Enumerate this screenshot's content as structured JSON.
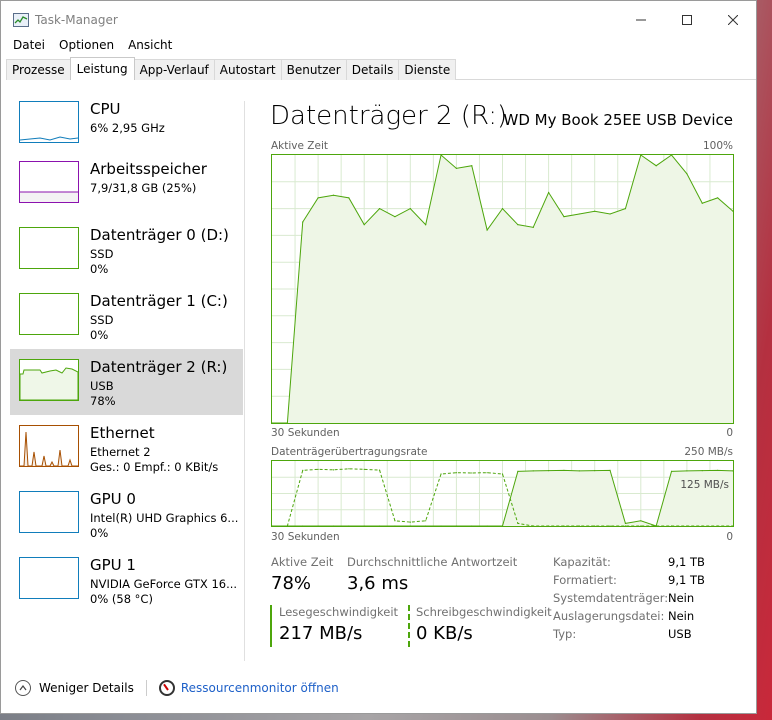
{
  "window": {
    "title": "Task-Manager",
    "menu": [
      "Datei",
      "Optionen",
      "Ansicht"
    ],
    "tabs": [
      "Prozesse",
      "Leistung",
      "App-Verlauf",
      "Autostart",
      "Benutzer",
      "Details",
      "Dienste"
    ],
    "active_tab": "Leistung"
  },
  "sidebar": {
    "items": [
      {
        "title": "CPU",
        "line1": "6% 2,95 GHz",
        "line2": "",
        "line3": "",
        "color": "#117dbb",
        "selected": false
      },
      {
        "title": "Arbeitsspeicher",
        "line1": "7,9/31,8 GB (25%)",
        "line2": "",
        "line3": "",
        "color": "#8b12ae",
        "selected": false
      },
      {
        "title": "Datenträger 0 (D:)",
        "line1": "SSD",
        "line2": "0%",
        "line3": "",
        "color": "#4da60c",
        "selected": false
      },
      {
        "title": "Datenträger 1 (C:)",
        "line1": "SSD",
        "line2": "0%",
        "line3": "",
        "color": "#4da60c",
        "selected": false
      },
      {
        "title": "Datenträger 2 (R:)",
        "line1": "USB",
        "line2": "78%",
        "line3": "",
        "color": "#4da60c",
        "selected": true
      },
      {
        "title": "Ethernet",
        "line1": "Ethernet 2",
        "line2": "Ges.: 0 Empf.: 0 KBit/s",
        "line3": "",
        "color": "#a74f01",
        "selected": false
      },
      {
        "title": "GPU 0",
        "line1": "Intel(R) UHD Graphics 6...",
        "line2": "0%",
        "line3": "",
        "color": "#117dbb",
        "selected": false
      },
      {
        "title": "GPU 1",
        "line1": "NVIDIA GeForce GTX 16...",
        "line2": "0% (58 °C)",
        "line3": "",
        "color": "#117dbb",
        "selected": false
      }
    ]
  },
  "main": {
    "title": "Datenträger 2 (R:)",
    "device": "WD My Book 25EE USB Device",
    "chart1_label": "Aktive Zeit",
    "chart1_max": "100%",
    "chart1_xleft": "30 Sekunden",
    "chart1_xright": "0",
    "chart2_label": "Datenträgerübertragungsrate",
    "chart2_max": "250 MB/s",
    "chart2_mid": "125 MB/s",
    "chart2_xleft": "30 Sekunden",
    "chart2_xright": "0",
    "stats": {
      "active_label": "Aktive Zeit",
      "active_value": "78%",
      "resp_label": "Durchschnittliche Antwortzeit",
      "resp_value": "3,6 ms",
      "read_label": "Lesegeschwindigkeit",
      "read_value": "217 MB/s",
      "write_label": "Schreibgeschwindigkeit",
      "write_value": "0 KB/s"
    },
    "props": [
      {
        "label": "Kapazität:",
        "value": "9,1 TB"
      },
      {
        "label": "Formatiert:",
        "value": "9,1 TB"
      },
      {
        "label": "Systemdatenträger:",
        "value": "Nein"
      },
      {
        "label": "Auslagerungsdatei:",
        "value": "Nein"
      },
      {
        "label": "Typ:",
        "value": "USB"
      }
    ]
  },
  "footer": {
    "less_details": "Weniger Details",
    "resource_monitor": "Ressourcenmonitor öffnen"
  },
  "chart_data": [
    {
      "type": "area",
      "title": "Aktive Zeit",
      "ylim": [
        0,
        100
      ],
      "x": [
        -30,
        -29,
        -28,
        -27,
        -26,
        -25,
        -24,
        -23,
        -22,
        -21,
        -20,
        -19,
        -18,
        -17,
        -16,
        -15,
        -14,
        -13,
        -12,
        -11,
        -10,
        -9,
        -8,
        -7,
        -6,
        -5,
        -4,
        -3,
        -2,
        -1,
        0
      ],
      "series": [
        {
          "values": [
            0,
            0,
            75,
            84,
            85,
            84,
            74,
            80,
            77,
            80,
            74,
            100,
            95,
            96,
            72,
            80,
            74,
            73,
            86,
            77,
            78,
            79,
            78,
            80,
            100,
            96,
            100,
            93,
            82,
            84,
            79
          ]
        }
      ]
    },
    {
      "type": "line",
      "title": "Datenträgerübertragungsrate",
      "ylim": [
        0,
        250
      ],
      "x": [
        -30,
        -29,
        -28,
        -27,
        -26,
        -25,
        -24,
        -23,
        -22,
        -21,
        -20,
        -19,
        -18,
        -17,
        -16,
        -15,
        -14,
        -13,
        -12,
        -11,
        -10,
        -9,
        -8,
        -7,
        -6,
        -5,
        -4,
        -3,
        -2,
        -1,
        0
      ],
      "series": [
        {
          "name": "read",
          "values": [
            0,
            0,
            0,
            0,
            0,
            0,
            0,
            0,
            0,
            0,
            0,
            0,
            0,
            0,
            0,
            0,
            210,
            212,
            213,
            214,
            212,
            213,
            214,
            10,
            20,
            0,
            210,
            212,
            213,
            214,
            212
          ]
        },
        {
          "name": "write",
          "values": [
            0,
            0,
            214,
            218,
            216,
            220,
            218,
            215,
            20,
            15,
            20,
            200,
            205,
            204,
            205,
            200,
            10,
            0,
            0,
            0,
            0,
            0,
            0,
            0,
            0,
            0,
            0,
            0,
            0,
            0,
            0
          ]
        }
      ]
    }
  ]
}
